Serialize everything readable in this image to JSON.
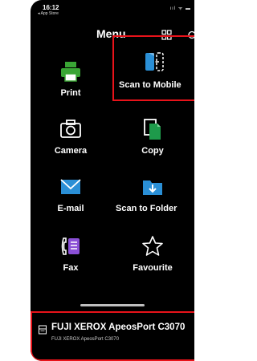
{
  "status_bar": {
    "time": "16:12",
    "back_app": "◂ App Store",
    "indicators": "ııl ᯤ ▬"
  },
  "header": {
    "title": "Menu"
  },
  "menu": {
    "items": [
      {
        "label": "Print",
        "icon": "printer-icon"
      },
      {
        "label": "Scan to Mobile",
        "icon": "scan-to-mobile-icon",
        "highlighted": true
      },
      {
        "label": "Camera",
        "icon": "camera-icon"
      },
      {
        "label": "Copy",
        "icon": "copy-icon"
      },
      {
        "label": "E-mail",
        "icon": "mail-icon"
      },
      {
        "label": "Scan to Folder",
        "icon": "folder-download-icon"
      },
      {
        "label": "Fax",
        "icon": "fax-icon"
      },
      {
        "label": "Favourite",
        "icon": "star-icon"
      }
    ]
  },
  "device": {
    "name": "FUJI XEROX ApeosPort C3070",
    "model": "FUJI XEROX ApeosPort C3070",
    "highlighted": true
  },
  "colors": {
    "highlight": "#e8131a",
    "print_green": "#3aa535",
    "accent_blue": "#2a8fd6",
    "copy_green": "#1e9a4b"
  }
}
